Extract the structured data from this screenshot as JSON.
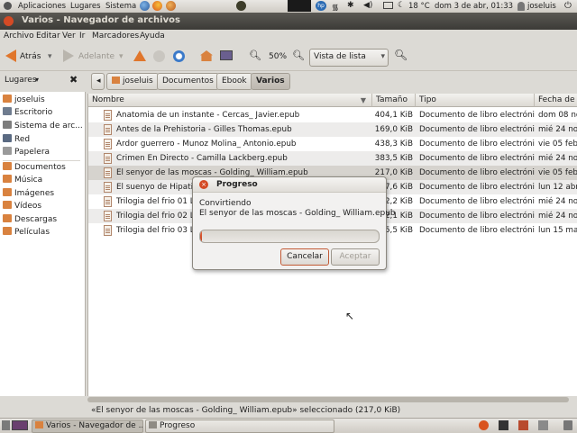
{
  "top_panel": {
    "menus": [
      "Aplicaciones",
      "Lugares",
      "Sistema"
    ],
    "weather": "18 °C",
    "clock": "dom  3 de abr, 01:33",
    "user": "joseluis"
  },
  "window": {
    "title": "Varios - Navegador de archivos"
  },
  "menubar": [
    "Archivo",
    "Editar",
    "Ver",
    "Ir",
    "Marcadores",
    "Ayuda"
  ],
  "toolbar": {
    "back_label": "Atrás",
    "forward_label": "Adelante",
    "zoom_level": "50%",
    "view_mode": "Vista de lista"
  },
  "breadcrumbs": [
    "joseluis",
    "Documentos",
    "Ebook",
    "Varios"
  ],
  "sidebar": {
    "header": "Lugares",
    "items": [
      {
        "label": "joseluis",
        "icon": "home-folder-icon",
        "color": "#d9823f"
      },
      {
        "label": "Escritorio",
        "icon": "desktop-icon",
        "color": "#6f7c8f"
      },
      {
        "label": "Sistema de arc...",
        "icon": "drive-icon",
        "color": "#7d7d7d"
      },
      {
        "label": "Red",
        "icon": "network-icon",
        "color": "#5a6a82"
      },
      {
        "label": "Papelera",
        "icon": "trash-icon",
        "color": "#9a9a9a"
      },
      {
        "label": "Documentos",
        "icon": "folder-icon",
        "color": "#d9823f"
      },
      {
        "label": "Música",
        "icon": "folder-icon",
        "color": "#d9823f"
      },
      {
        "label": "Imágenes",
        "icon": "folder-icon",
        "color": "#d9823f"
      },
      {
        "label": "Vídeos",
        "icon": "folder-icon",
        "color": "#d9823f"
      },
      {
        "label": "Descargas",
        "icon": "folder-icon",
        "color": "#d9823f"
      },
      {
        "label": "Películas",
        "icon": "folder-icon",
        "color": "#d9823f"
      }
    ]
  },
  "file_list": {
    "columns": [
      "Nombre",
      "Tamaño",
      "Tipo",
      "Fecha de m"
    ],
    "rows": [
      {
        "name": "Anatomia de un instante - Cercas_ Javier.epub",
        "size": "404,1 KiB",
        "type": "Documento de libro electrónico",
        "date": "dom 08 no"
      },
      {
        "name": "Antes de la Prehistoria - Gilles Thomas.epub",
        "size": "169,0 KiB",
        "type": "Documento de libro electrónico",
        "date": "mié 24 nov"
      },
      {
        "name": "Ardor guerrero - Munoz Molina_ Antonio.epub",
        "size": "438,3 KiB",
        "type": "Documento de libro electrónico",
        "date": "vie 05 feb"
      },
      {
        "name": "Crimen En Directo - Camilla Lackberg.epub",
        "size": "383,5 KiB",
        "type": "Documento de libro electrónico",
        "date": "mié 24 nov"
      },
      {
        "name": "El senyor de las moscas - Golding_ William.epub",
        "size": "217,0 KiB",
        "type": "Documento de libro electrónico",
        "date": "vie 05 feb"
      },
      {
        "name": "El suenyo de Hipatia",
        "size": "37,6 KiB",
        "type": "Documento de libro electrónico",
        "date": "lun 12 abr"
      },
      {
        "name": "Trilogia del frio 01 La",
        "size": "2,2 KiB",
        "type": "Documento de libro electrónico",
        "date": "mié 24 nov"
      },
      {
        "name": "Trilogia del frio 02 Lo",
        "size": "2,1 KiB",
        "type": "Documento de libro electrónico",
        "date": "mié 24 nov"
      },
      {
        "name": "Trilogia del frio 03 La",
        "size": "5,5 KiB",
        "type": "Documento de libro electrónico",
        "date": "lun 15 mar"
      }
    ]
  },
  "statusbar": {
    "text": "«El senyor de las moscas - Golding_ William.epub» seleccionado (217,0 KiB)"
  },
  "dialog": {
    "title": "Progreso",
    "line1": "Convirtiendo",
    "line2": "El senyor de las moscas - Golding_ William.epub",
    "progress": 0.01,
    "cancel_label": "Cancelar",
    "accept_label": "Aceptar"
  },
  "taskbar": {
    "tasks": [
      "Varios - Navegador de ...",
      "Progreso"
    ]
  }
}
